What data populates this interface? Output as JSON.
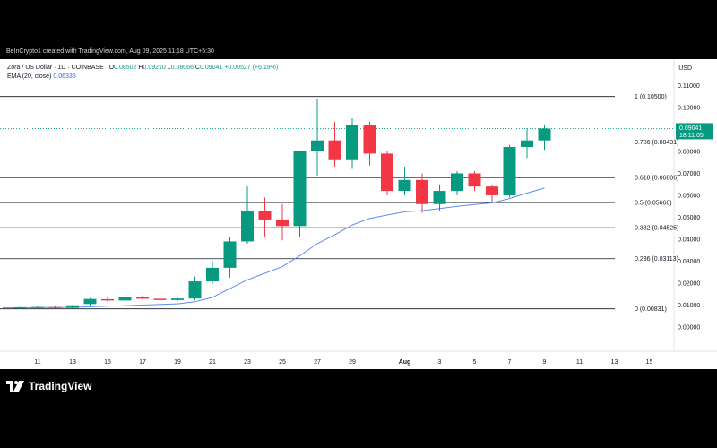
{
  "caption": "BeInCrypto1 created with TradingView.com, Aug 09, 2025 11:18 UTC+5:30",
  "legend": {
    "symbol": "Zora / US Dollar · 1D · COINBASE",
    "o_label": "O",
    "o": "0.08502",
    "h_label": "H",
    "h": "0.09210",
    "l_label": "L",
    "l": "0.08066",
    "c_label": "C",
    "c": "0.09041",
    "change": "+0.00527 (+6.19%)",
    "ema_label": "EMA (20, close)",
    "ema": "0.06335"
  },
  "currency": "USD",
  "price_box": {
    "price": "0.09041",
    "countdown": "18:11:05"
  },
  "footer_logo": "TradingView",
  "colors": {
    "up": "#089981",
    "down": "#f23645",
    "ema": "#5b8def",
    "fib": "#131722",
    "price_line": "#089981",
    "bg": "#ffffff"
  },
  "chart_data": {
    "type": "candlestick",
    "ylim": [
      -0.011,
      0.122
    ],
    "x_range": [
      0,
      19
    ],
    "y_ticks": [
      "0.11000",
      "0.10000",
      "0.09000",
      "0.08000",
      "0.07000",
      "0.06000",
      "0.05000",
      "0.04000",
      "0.03000",
      "0.02000",
      "0.01000",
      "0.00000"
    ],
    "y_tick_values": [
      0.11,
      0.1,
      0.09,
      0.08,
      0.07,
      0.06,
      0.05,
      0.04,
      0.03,
      0.02,
      0.01,
      0.0
    ],
    "x_ticks": [
      {
        "label": "11",
        "x": 1
      },
      {
        "label": "13",
        "x": 2
      },
      {
        "label": "15",
        "x": 3
      },
      {
        "label": "17",
        "x": 4
      },
      {
        "label": "19",
        "x": 5
      },
      {
        "label": "21",
        "x": 6
      },
      {
        "label": "23",
        "x": 7
      },
      {
        "label": "25",
        "x": 8
      },
      {
        "label": "27",
        "x": 9
      },
      {
        "label": "29",
        "x": 10
      },
      {
        "label": "Aug",
        "x": 11.5
      },
      {
        "label": "3",
        "x": 12.5
      },
      {
        "label": "5",
        "x": 13.5
      },
      {
        "label": "7",
        "x": 14.5
      },
      {
        "label": "9",
        "x": 15.5
      },
      {
        "label": "11",
        "x": 16.5
      },
      {
        "label": "13",
        "x": 17.5
      },
      {
        "label": "15",
        "x": 18.5
      }
    ],
    "candles": [
      {
        "x": 0.5,
        "o": 0.0088,
        "h": 0.0092,
        "l": 0.0083,
        "c": 0.0089
      },
      {
        "x": 1.0,
        "o": 0.0089,
        "h": 0.0096,
        "l": 0.0085,
        "c": 0.0091
      },
      {
        "x": 1.5,
        "o": 0.0091,
        "h": 0.0094,
        "l": 0.0086,
        "c": 0.0087
      },
      {
        "x": 2.0,
        "o": 0.0087,
        "h": 0.0102,
        "l": 0.0084,
        "c": 0.0099
      },
      {
        "x": 2.5,
        "o": 0.0105,
        "h": 0.0132,
        "l": 0.0098,
        "c": 0.0128
      },
      {
        "x": 3.0,
        "o": 0.0127,
        "h": 0.0136,
        "l": 0.0116,
        "c": 0.0121
      },
      {
        "x": 3.5,
        "o": 0.0121,
        "h": 0.015,
        "l": 0.0115,
        "c": 0.0137
      },
      {
        "x": 4.0,
        "o": 0.0137,
        "h": 0.0143,
        "l": 0.0126,
        "c": 0.0129
      },
      {
        "x": 4.5,
        "o": 0.0129,
        "h": 0.0136,
        "l": 0.0118,
        "c": 0.0123
      },
      {
        "x": 5.0,
        "o": 0.0123,
        "h": 0.0138,
        "l": 0.0119,
        "c": 0.013
      },
      {
        "x": 5.5,
        "o": 0.013,
        "h": 0.023,
        "l": 0.0122,
        "c": 0.0208
      },
      {
        "x": 6.0,
        "o": 0.0208,
        "h": 0.03,
        "l": 0.0195,
        "c": 0.027
      },
      {
        "x": 6.5,
        "o": 0.027,
        "h": 0.041,
        "l": 0.0225,
        "c": 0.039
      },
      {
        "x": 7.0,
        "o": 0.039,
        "h": 0.064,
        "l": 0.038,
        "c": 0.053
      },
      {
        "x": 7.5,
        "o": 0.053,
        "h": 0.059,
        "l": 0.041,
        "c": 0.049
      },
      {
        "x": 8.0,
        "o": 0.049,
        "h": 0.056,
        "l": 0.0395,
        "c": 0.046
      },
      {
        "x": 8.5,
        "o": 0.046,
        "h": 0.06,
        "l": 0.041,
        "c": 0.08
      },
      {
        "x": 9.0,
        "o": 0.08,
        "h": 0.104,
        "l": 0.069,
        "c": 0.085
      },
      {
        "x": 9.5,
        "o": 0.085,
        "h": 0.0935,
        "l": 0.073,
        "c": 0.076
      },
      {
        "x": 10.0,
        "o": 0.076,
        "h": 0.095,
        "l": 0.072,
        "c": 0.092
      },
      {
        "x": 10.5,
        "o": 0.092,
        "h": 0.0935,
        "l": 0.0735,
        "c": 0.079
      },
      {
        "x": 11.0,
        "o": 0.079,
        "h": 0.08,
        "l": 0.06,
        "c": 0.062
      },
      {
        "x": 11.5,
        "o": 0.062,
        "h": 0.073,
        "l": 0.06,
        "c": 0.067
      },
      {
        "x": 12.0,
        "o": 0.067,
        "h": 0.07,
        "l": 0.052,
        "c": 0.056
      },
      {
        "x": 12.5,
        "o": 0.056,
        "h": 0.065,
        "l": 0.053,
        "c": 0.062
      },
      {
        "x": 13.0,
        "o": 0.062,
        "h": 0.071,
        "l": 0.06,
        "c": 0.07
      },
      {
        "x": 13.5,
        "o": 0.07,
        "h": 0.071,
        "l": 0.062,
        "c": 0.064
      },
      {
        "x": 14.0,
        "o": 0.064,
        "h": 0.065,
        "l": 0.057,
        "c": 0.06
      },
      {
        "x": 14.5,
        "o": 0.06,
        "h": 0.083,
        "l": 0.059,
        "c": 0.082
      },
      {
        "x": 15.0,
        "o": 0.082,
        "h": 0.0905,
        "l": 0.077,
        "c": 0.085
      },
      {
        "x": 15.5,
        "o": 0.085,
        "h": 0.0921,
        "l": 0.0807,
        "c": 0.0904
      }
    ],
    "ema": [
      {
        "x": 0,
        "y": 0.0088
      },
      {
        "x": 2.0,
        "y": 0.009
      },
      {
        "x": 3.0,
        "y": 0.0095
      },
      {
        "x": 4.0,
        "y": 0.01
      },
      {
        "x": 5.0,
        "y": 0.0106
      },
      {
        "x": 5.5,
        "y": 0.0115
      },
      {
        "x": 6.0,
        "y": 0.0135
      },
      {
        "x": 6.5,
        "y": 0.0175
      },
      {
        "x": 7.0,
        "y": 0.0215
      },
      {
        "x": 7.5,
        "y": 0.0245
      },
      {
        "x": 8.0,
        "y": 0.0275
      },
      {
        "x": 8.5,
        "y": 0.0325
      },
      {
        "x": 9.0,
        "y": 0.038
      },
      {
        "x": 9.5,
        "y": 0.042
      },
      {
        "x": 10.0,
        "y": 0.0465
      },
      {
        "x": 10.5,
        "y": 0.0495
      },
      {
        "x": 11.0,
        "y": 0.051
      },
      {
        "x": 11.5,
        "y": 0.0525
      },
      {
        "x": 12.0,
        "y": 0.053
      },
      {
        "x": 12.5,
        "y": 0.054
      },
      {
        "x": 13.0,
        "y": 0.055
      },
      {
        "x": 13.5,
        "y": 0.0558
      },
      {
        "x": 14.0,
        "y": 0.0565
      },
      {
        "x": 14.5,
        "y": 0.0585
      },
      {
        "x": 15.0,
        "y": 0.061
      },
      {
        "x": 15.5,
        "y": 0.0633
      }
    ],
    "fib_levels": [
      {
        "label": "1 (0.10500)",
        "y": 0.105
      },
      {
        "label": "0.786 (0.08431)",
        "y": 0.08431
      },
      {
        "label": "0.618 (0.06806)",
        "y": 0.06806
      },
      {
        "label": "0.5 (0.05666)",
        "y": 0.05666
      },
      {
        "label": "0.382 (0.04525)",
        "y": 0.04525
      },
      {
        "label": "0.236 (0.03113)",
        "y": 0.03113
      },
      {
        "label": "0 (0.00831)",
        "y": 0.00831
      }
    ],
    "last_price": 0.09041
  }
}
